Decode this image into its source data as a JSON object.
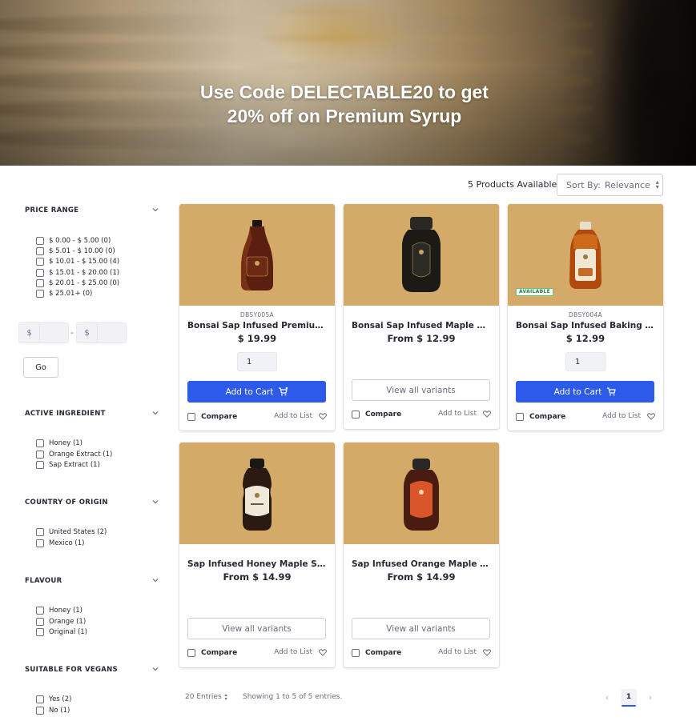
{
  "hero": {
    "line1": "Use Code DELECTABLE20 to get",
    "line2": "20% off on Premium Syrup",
    "image_subject": "stack of pancakes with syrup drip"
  },
  "toolbar": {
    "count": "5 Products Available",
    "sort_label": "Sort By:",
    "sort_value": "Relevance"
  },
  "filters": {
    "price_range": {
      "title": "PRICE RANGE",
      "options": [
        "$ 0.00 - $ 5.00 (0)",
        "$ 5.01 - $ 10.00 (0)",
        "$ 10.01 - $ 15.00 (4)",
        "$ 15.01 - $ 20.00 (1)",
        "$ 20.01 - $ 25.00 (0)",
        "$ 25.01+ (0)"
      ],
      "currency": "$",
      "separator": "-",
      "go_label": "Go"
    },
    "active_ingredient": {
      "title": "ACTIVE INGREDIENT",
      "options": [
        "Honey (1)",
        "Orange Extract (1)",
        "Sap Extract (1)"
      ]
    },
    "country_of_origin": {
      "title": "COUNTRY OF ORIGIN",
      "options": [
        "United States (2)",
        "Mexico (1)"
      ]
    },
    "flavour": {
      "title": "FLAVOUR",
      "options": [
        "Honey (1)",
        "Orange (1)",
        "Original (1)"
      ]
    },
    "suitable_for_vegans": {
      "title": "SUITABLE FOR VEGANS",
      "options": [
        "Yes (2)",
        "No (1)"
      ]
    }
  },
  "products": [
    {
      "sku": "DBSY005A",
      "name": "Bonsai Sap Infused Premium Syrup",
      "price": "$ 19.99",
      "qty": "1",
      "action": "Add to Cart",
      "compare": "Compare",
      "add_to_list": "Add to List"
    },
    {
      "sku": "",
      "name": "Bonsai Sap Infused Maple Syrup",
      "price": "From $ 12.99",
      "action": "View all variants",
      "compare": "Compare",
      "add_to_list": "Add to List"
    },
    {
      "sku": "DBSY004A",
      "name": "Bonsai Sap Infused Baking Syrup",
      "price": "$ 12.99",
      "qty": "1",
      "action": "Add to Cart",
      "badge": "AVAILABLE",
      "compare": "Compare",
      "add_to_list": "Add to List"
    },
    {
      "sku": "",
      "name": "Sap Infused Honey Maple Syrup",
      "price": "From $ 14.99",
      "action": "View all variants",
      "compare": "Compare",
      "add_to_list": "Add to List"
    },
    {
      "sku": "",
      "name": "Sap Infused Orange Maple Syrup",
      "price": "From $ 14.99",
      "action": "View all variants",
      "compare": "Compare",
      "add_to_list": "Add to List"
    }
  ],
  "pagination": {
    "entries": "20 Entries",
    "showing": "Showing 1 to 5 of 5 entries.",
    "current_page": "1"
  },
  "colors": {
    "primary": "#2e5aec",
    "product_bg": "#d4aa68",
    "available_green": "#287d3c"
  }
}
